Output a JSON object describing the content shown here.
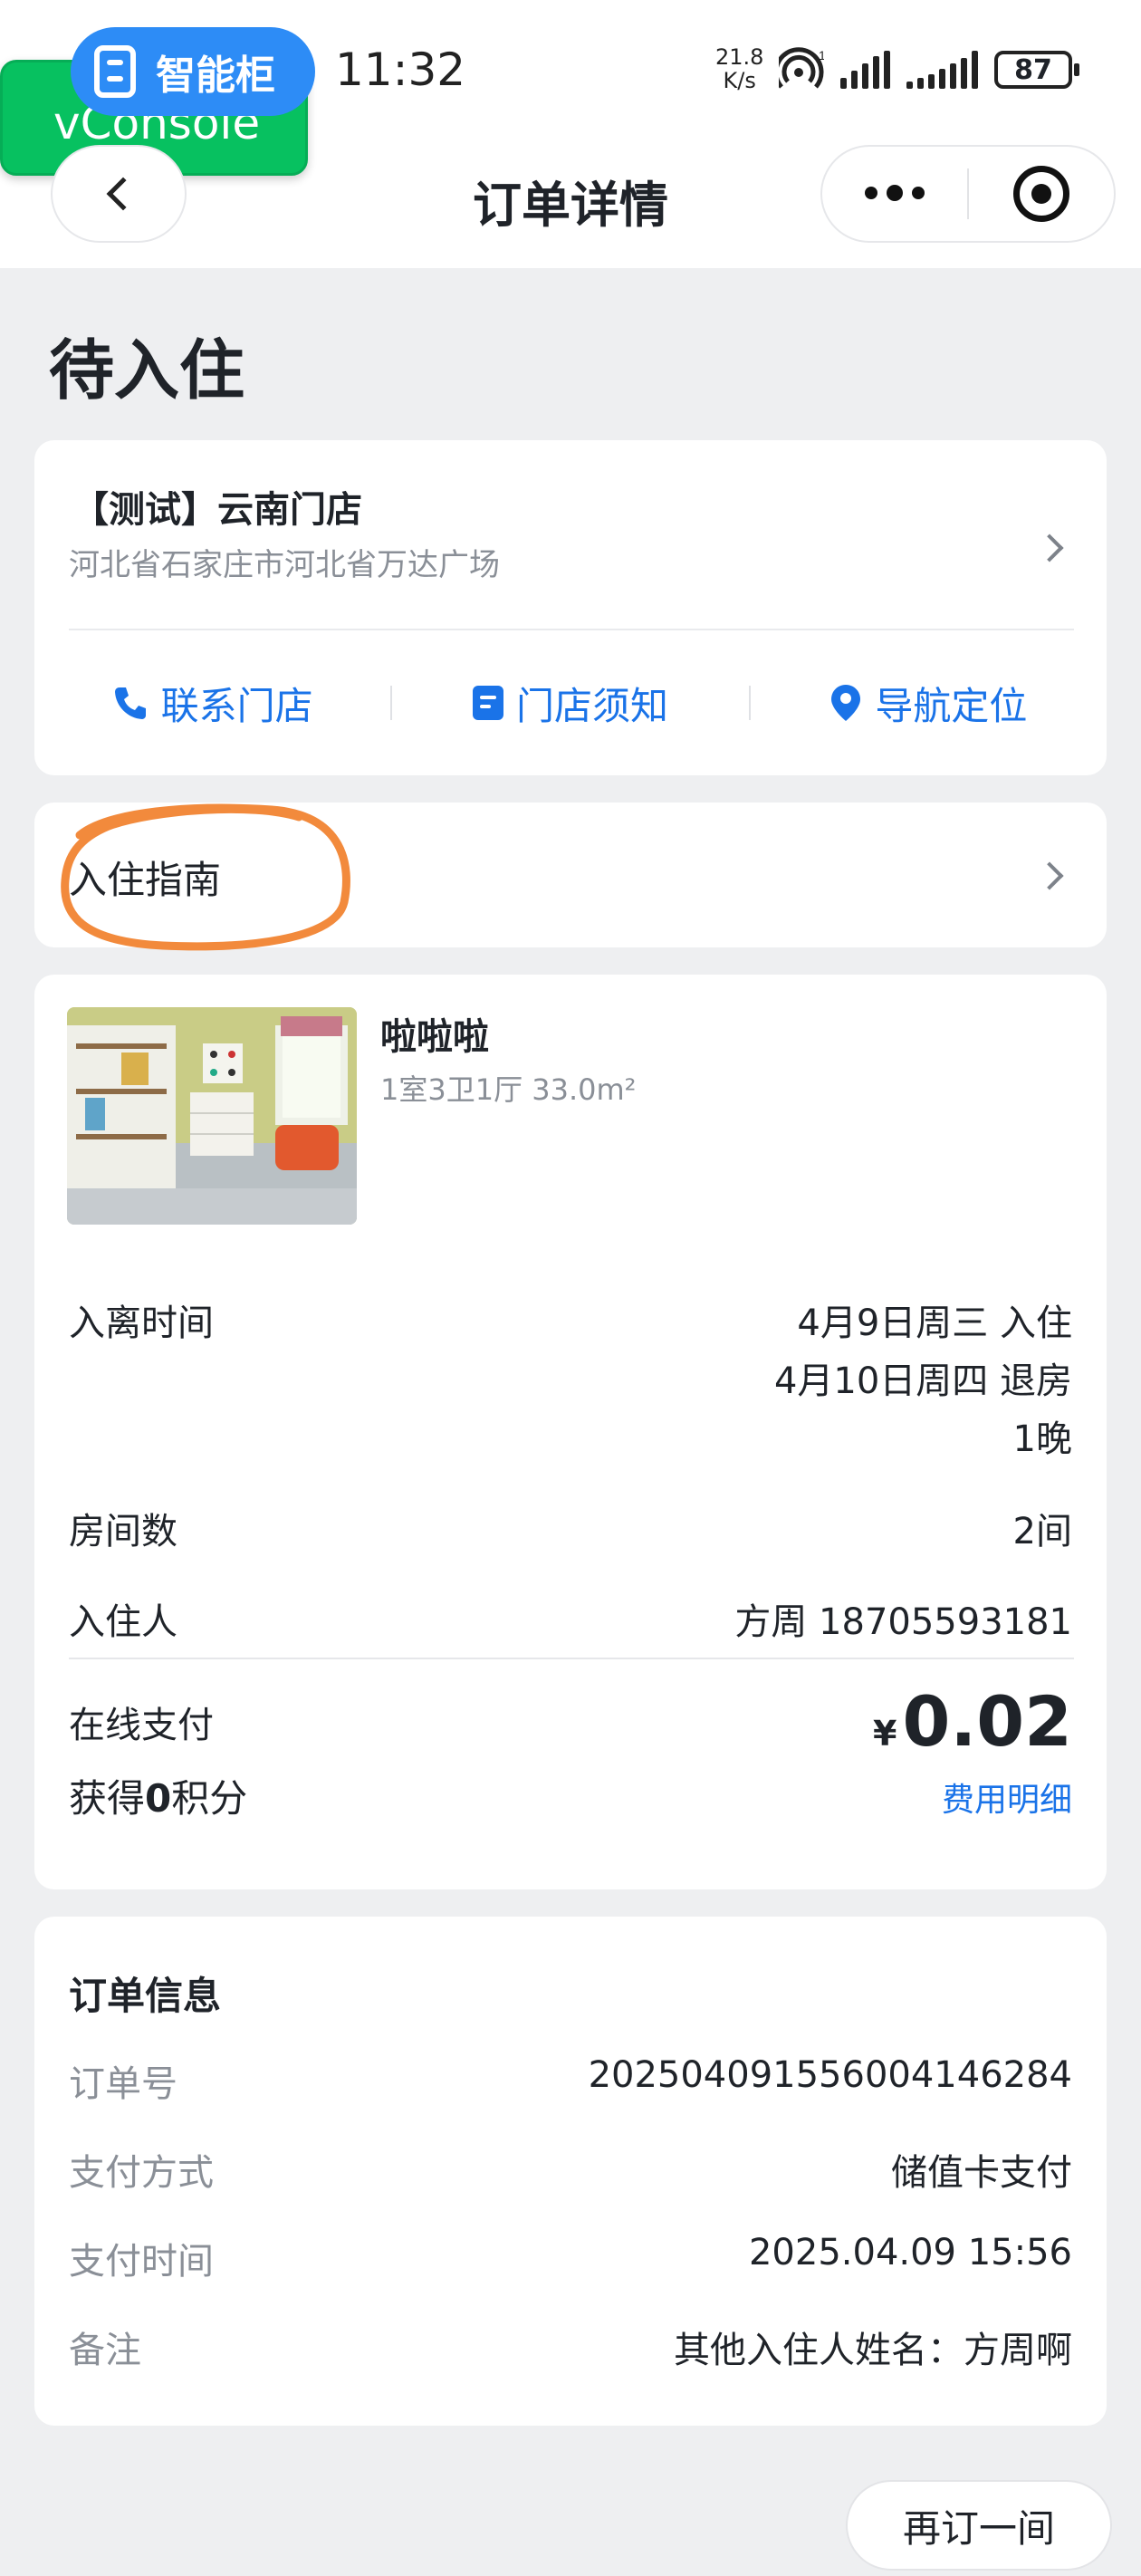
{
  "status_bar": {
    "app_name": "智能柜",
    "debug_tool": "vConsole",
    "time": "11:32",
    "net_speed_value": "21.8",
    "net_speed_unit": "K/s",
    "hotspot_badge": "1",
    "battery": "87"
  },
  "nav": {
    "title": "订单详情"
  },
  "order_status": "待入住",
  "store": {
    "name": "【测试】云南门店",
    "address": "河北省石家庄市河北省万达广场",
    "actions": [
      {
        "label": "联系门店",
        "icon": "phone-icon"
      },
      {
        "label": "门店须知",
        "icon": "document-icon"
      },
      {
        "label": "导航定位",
        "icon": "location-pin-icon"
      }
    ]
  },
  "guide": {
    "label": "入住指南",
    "annotation_color": "#f28a3c"
  },
  "room": {
    "name": "啦啦啦",
    "spec": "1室3卫1厅 33.0m²",
    "stay_label": "入离时间",
    "checkin": "4月9日周三 入住",
    "checkout": "4月10日周四 退房",
    "nights": "1晚",
    "rooms_label": "房间数",
    "rooms_value": "2间",
    "guest_label": "入住人",
    "guest_value": "方周 18705593181",
    "payment_label": "在线支付",
    "currency": "¥",
    "amount": "0.02",
    "points_prefix": "获得",
    "points_value": "0",
    "points_suffix": "积分",
    "fee_link": "费用明细"
  },
  "order_info": {
    "heading": "订单信息",
    "rows": [
      {
        "label": "订单号",
        "value": "20250409155600414628​4"
      },
      {
        "label": "支付方式",
        "value": "储值卡支付"
      },
      {
        "label": "支付时间",
        "value": "2025.04.09 15:56"
      },
      {
        "label": "备注",
        "value": "其他入住人姓名：方周啊"
      }
    ]
  },
  "rebook_button": "再订一间",
  "colors": {
    "accent": "#1a73e8",
    "page_bg": "#eeeff1",
    "vconsole_green": "#07c160",
    "app_pill_blue": "#2d8cf6"
  }
}
